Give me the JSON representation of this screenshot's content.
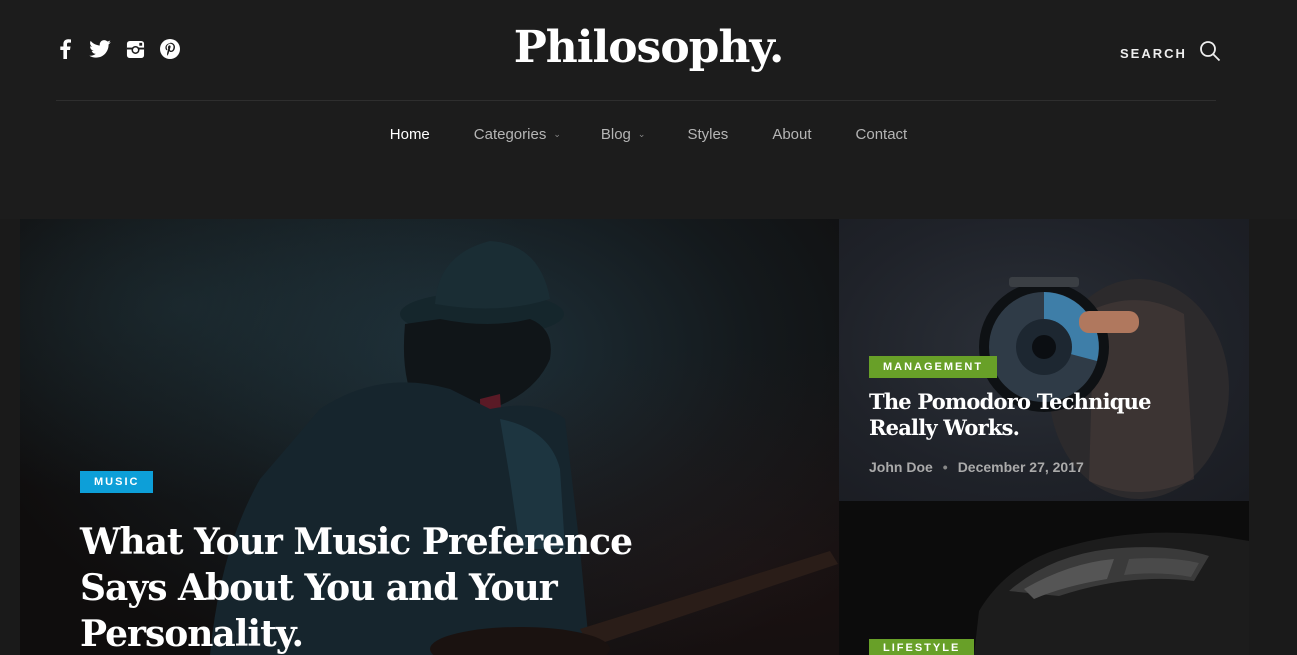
{
  "header": {
    "logo": "Philosophy.",
    "search_label": "SEARCH",
    "social": [
      "facebook-icon",
      "twitter-icon",
      "instagram-icon",
      "pinterest-icon"
    ]
  },
  "nav": {
    "items": [
      {
        "label": "Home",
        "active": true,
        "dropdown": false
      },
      {
        "label": "Categories",
        "active": false,
        "dropdown": true
      },
      {
        "label": "Blog",
        "active": false,
        "dropdown": true
      },
      {
        "label": "Styles",
        "active": false,
        "dropdown": false
      },
      {
        "label": "About",
        "active": false,
        "dropdown": false
      },
      {
        "label": "Contact",
        "active": false,
        "dropdown": false
      }
    ],
    "chevron": "⌄"
  },
  "featured": {
    "category": "MUSIC",
    "category_color": "#0d9fd8",
    "title": "What Your Music Preference Says About You and Your Personality."
  },
  "side_posts": [
    {
      "category": "MANAGEMENT",
      "category_color": "#68a028",
      "title": "The Pomodoro Technique Really Works.",
      "author": "John Doe",
      "separator": "•",
      "date": "December 27, 2017"
    },
    {
      "category": "LIFESTYLE",
      "category_color": "#68a028"
    }
  ]
}
